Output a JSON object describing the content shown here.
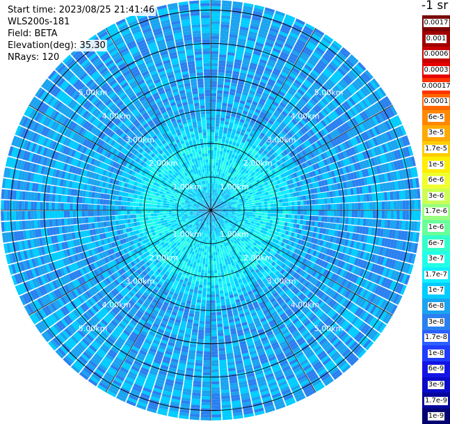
{
  "chart_data": {
    "type": "heatmap",
    "projection": "polar-ppi",
    "meta": {
      "start_time": "Start time: 2023/08/25 21:41:46",
      "instrument": "WLS200s-181",
      "field": "Field: BETA",
      "elevation": "Elevation(deg): 35.30",
      "nrays": "NRays: 120"
    },
    "units": "-1 sr",
    "range_unit": "km",
    "max_range_km": 6.3,
    "n_rays": 120,
    "rings_km": [
      1,
      2,
      3,
      4,
      5,
      6
    ],
    "range_labels": [
      "1.00km",
      "2.00km",
      "3.00km",
      "4.00km",
      "5.00km"
    ],
    "grid_spokes_deg": [
      0,
      30,
      60,
      90,
      120,
      150,
      180,
      210,
      240,
      270,
      300,
      330
    ],
    "colorbar": {
      "labels": [
        "0.0017",
        "0.001",
        "0.0006",
        "0.0003",
        "0.00017",
        "0.0001",
        "6e-5",
        "3e-5",
        "1.7e-5",
        "1e-5",
        "6e-6",
        "3e-6",
        "1.7e-6",
        "1e-6",
        "6e-7",
        "3e-7",
        "1.7e-7",
        "1e-7",
        "6e-8",
        "3e-8",
        "1.7e-8",
        "1e-8",
        "6e-9",
        "3e-9",
        "1.7e-9",
        "1e-9"
      ],
      "colors": [
        "#7a0000",
        "#a00000",
        "#c80000",
        "#e60000",
        "#ff3300",
        "#ff6600",
        "#ff8800",
        "#ffaa00",
        "#ffcc00",
        "#ffee00",
        "#f0ff30",
        "#ccff55",
        "#99ff80",
        "#66ff99",
        "#33ffcc",
        "#22ffe6",
        "#11eeff",
        "#00ccff",
        "#1aa3f0",
        "#2a80f0",
        "#2b60ff",
        "#1f3cff",
        "#1414e6",
        "#0a0ac8",
        "#05059a",
        "#000070"
      ]
    },
    "radial_profile": {
      "range_km": [
        0,
        0.5,
        1.0,
        1.5,
        2.0,
        2.5,
        3.0,
        4.0,
        5.0,
        6.3
      ],
      "dominant_color_index": [
        18,
        17,
        16,
        16,
        16,
        17,
        18,
        18,
        18,
        18
      ]
    }
  }
}
